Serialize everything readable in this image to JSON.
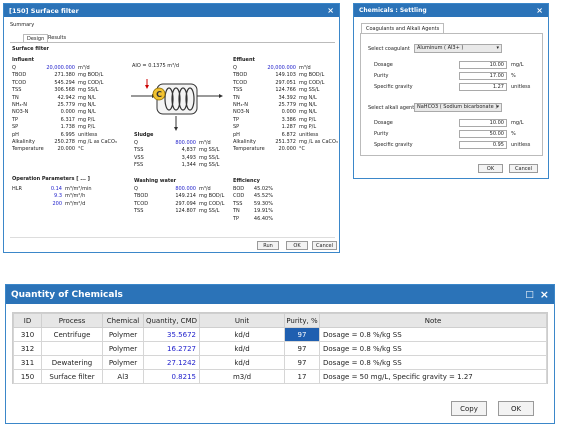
{
  "surface_filter_window": {
    "title": "[150] Surface filter",
    "summary_label": "Summary",
    "tabs": [
      "Design",
      "Results"
    ],
    "section_title": "Surface filter",
    "influent": {
      "header": "Influent",
      "rows": [
        {
          "label": "Q",
          "value": "20,000.000",
          "unit": "m³/d",
          "highlight": true
        },
        {
          "label": "TBOD",
          "value": "271.380",
          "unit": "mg BOD/L"
        },
        {
          "label": "TCOD",
          "value": "545.294",
          "unit": "mg COD/L"
        },
        {
          "label": "TSS",
          "value": "306.568",
          "unit": "mg SS/L"
        },
        {
          "label": "TN",
          "value": "42.942",
          "unit": "mg N/L"
        },
        {
          "label": "NH₄-N",
          "value": "25.779",
          "unit": "mg N/L"
        },
        {
          "label": "NO3-N",
          "value": "0.000",
          "unit": "mg N/L"
        },
        {
          "label": "TP",
          "value": "6.317",
          "unit": "mg P/L"
        },
        {
          "label": "SP",
          "value": "1.738",
          "unit": "mg P/L"
        },
        {
          "label": "pH",
          "value": "6.995",
          "unit": "unitless"
        },
        {
          "label": "Alkalinity",
          "value": "250.278",
          "unit": "mg /L as CaCO₃"
        },
        {
          "label": "Temperature",
          "value": "20.000",
          "unit": "°C"
        }
      ]
    },
    "aio_label": "AIO = 0.1375 m³/d",
    "effluent": {
      "header": "Effluent",
      "rows": [
        {
          "label": "Q",
          "value": "20,000.000",
          "unit": "m³/d",
          "highlight": true
        },
        {
          "label": "TBOD",
          "value": "149.103",
          "unit": "mg BOD/L"
        },
        {
          "label": "TCOD",
          "value": "297.051",
          "unit": "mg COD/L"
        },
        {
          "label": "TSS",
          "value": "124.766",
          "unit": "mg SS/L"
        },
        {
          "label": "TN",
          "value": "34.392",
          "unit": "mg N/L"
        },
        {
          "label": "NH₄-N",
          "value": "25.779",
          "unit": "mg N/L"
        },
        {
          "label": "NO3-N",
          "value": "0.000",
          "unit": "mg N/L"
        },
        {
          "label": "TP",
          "value": "3.386",
          "unit": "mg P/L"
        },
        {
          "label": "SP",
          "value": "1.287",
          "unit": "mg P/L"
        },
        {
          "label": "pH",
          "value": "6.872",
          "unit": "unitless"
        },
        {
          "label": "Alkalinity",
          "value": "251.372",
          "unit": "mg /L as CaCO₃"
        },
        {
          "label": "Temperature",
          "value": "20.000",
          "unit": "°C"
        }
      ]
    },
    "sludge": {
      "header": "Sludge",
      "rows": [
        {
          "label": "Q",
          "value": "800.000",
          "unit": "m³/d",
          "highlight": true
        },
        {
          "label": "TSS",
          "value": "4,837",
          "unit": "mg SS/L"
        },
        {
          "label": "VSS",
          "value": "3,493",
          "unit": "mg SS/L"
        },
        {
          "label": "FSS",
          "value": "1,344",
          "unit": "mg SS/L"
        }
      ]
    },
    "operation": {
      "header": "Operation Parameters [ ... ]",
      "rows": [
        {
          "label": "HLR",
          "value": "0.14",
          "unit": "m³/m²/min"
        },
        {
          "label": "",
          "value": "9.3",
          "unit": "m³/m²/h"
        },
        {
          "label": "",
          "value": "200",
          "unit": "m³/m²/d"
        }
      ]
    },
    "washing": {
      "header": "Washing water",
      "rows": [
        {
          "label": "Q",
          "value": "800.000",
          "unit": "m³/d",
          "highlight": true
        },
        {
          "label": "TBOD",
          "value": "149.214",
          "unit": "mg BOD/L"
        },
        {
          "label": "TCOD",
          "value": "297.094",
          "unit": "mg COD/L"
        },
        {
          "label": "TSS",
          "value": "124.807",
          "unit": "mg SS/L"
        }
      ]
    },
    "efficiency": {
      "header": "Efficiency",
      "rows": [
        {
          "label": "BOD",
          "value": "45.02%"
        },
        {
          "label": "COD",
          "value": "45.52%"
        },
        {
          "label": "TSS",
          "value": "59.30%"
        },
        {
          "label": "TN",
          "value": "19.91%"
        },
        {
          "label": "TP",
          "value": "46.40%"
        }
      ]
    },
    "buttons": {
      "run": "Run",
      "ok": "OK",
      "cancel": "Cancel"
    }
  },
  "settling_window": {
    "title": "Chemicals : Settling",
    "tab": "Coagulants and Alkali Agents",
    "coagulant": {
      "label": "Select coagulant",
      "selected": "Aluminum ( Al3+ )",
      "rows": [
        {
          "label": "Dosage",
          "value": "10.00",
          "unit": "mg/L"
        },
        {
          "label": "Purity",
          "value": "17.00",
          "unit": "%"
        },
        {
          "label": "Specific gravity",
          "value": "1.27",
          "unit": "unitless"
        }
      ]
    },
    "alkali": {
      "label": "Select alkali agent",
      "selected": "NaHCO3 ( Sodium bicarbonate )",
      "rows": [
        {
          "label": "Dosage",
          "value": "10.00",
          "unit": "mg/L"
        },
        {
          "label": "Purity",
          "value": "50.00",
          "unit": "%"
        },
        {
          "label": "Specific gravity",
          "value": "0.95",
          "unit": "unitless"
        }
      ]
    },
    "buttons": {
      "ok": "OK",
      "cancel": "Cancel"
    }
  },
  "quantity_window": {
    "title": "Quantity of Chemicals",
    "columns": [
      "ID",
      "Process",
      "Chemical",
      "Quantity, CMD",
      "Unit",
      "Purity, %",
      "Note"
    ],
    "rows": [
      {
        "id": "310",
        "process": "Centrifuge",
        "chemical": "Polymer",
        "quantity": "35.5672",
        "unit": "kd/d",
        "purity": "97",
        "note": "Dosage = 0.8 %/kg SS"
      },
      {
        "id": "312",
        "process": "",
        "chemical": "Polymer",
        "quantity": "16.2727",
        "unit": "kd/d",
        "purity": "97",
        "note": "Dosage = 0.8 %/kg SS"
      },
      {
        "id": "311",
        "process": "Dewatering",
        "chemical": "Polymer",
        "quantity": "27.1242",
        "unit": "kd/d",
        "purity": "97",
        "note": "Dosage = 0.8 %/kg SS"
      },
      {
        "id": "150",
        "process": "Surface filter",
        "chemical": "Al3",
        "quantity": "0.8215",
        "unit": "m3/d",
        "purity": "17",
        "note": "Dosage = 50 mg/L, Specific gravity = 1.27"
      }
    ],
    "buttons": {
      "copy": "Copy",
      "ok": "OK"
    }
  },
  "colors": {
    "titlebar": "#2b73b8",
    "highlight_cell": "#1f5fb0",
    "value_blue": "#2222cc"
  }
}
